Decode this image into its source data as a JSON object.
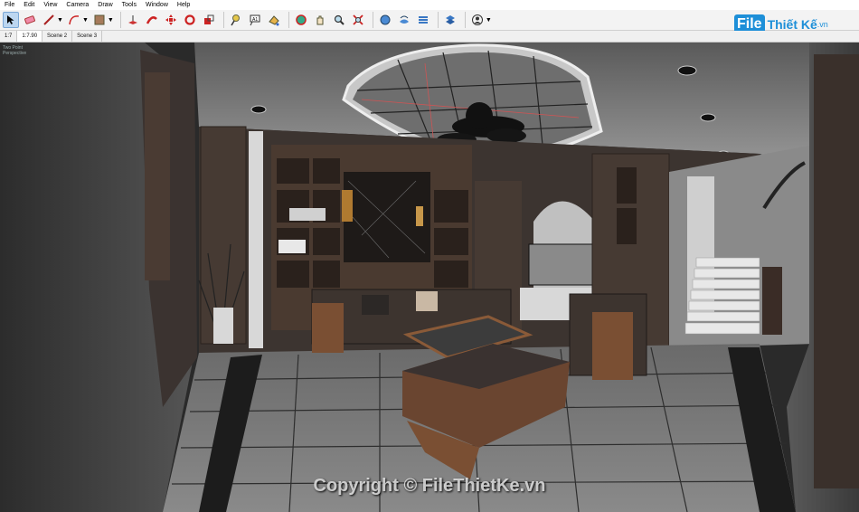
{
  "menu": [
    "File",
    "Edit",
    "View",
    "Camera",
    "Draw",
    "Tools",
    "Window",
    "Help"
  ],
  "toolbar": {
    "icons": [
      "select-icon",
      "eraser-icon",
      "pencil-icon",
      "arc-icon",
      "paint-bucket-icon",
      "push-pull-icon",
      "follow-me-icon",
      "move-icon",
      "rotate-icon",
      "scale-icon",
      "tape-measure-icon",
      "text-icon",
      "paint-icon",
      "orbit-icon",
      "pan-icon",
      "zoom-icon",
      "zoom-extents-icon",
      "components-icon",
      "materials-icon",
      "styles-icon",
      "layers-icon",
      "user-icon"
    ]
  },
  "scenes": {
    "scale_a": "1:7",
    "scale_b": "1:7.90",
    "tab1": "Scene 2",
    "tab2": "Scene 3"
  },
  "viewport": {
    "line1": "Two Point",
    "line2": "Perspective"
  },
  "logo": {
    "file": "File",
    "rest": "Thiết Kế",
    "vn": ".vn"
  },
  "watermark": "Copyright © FileThietKe.vn"
}
